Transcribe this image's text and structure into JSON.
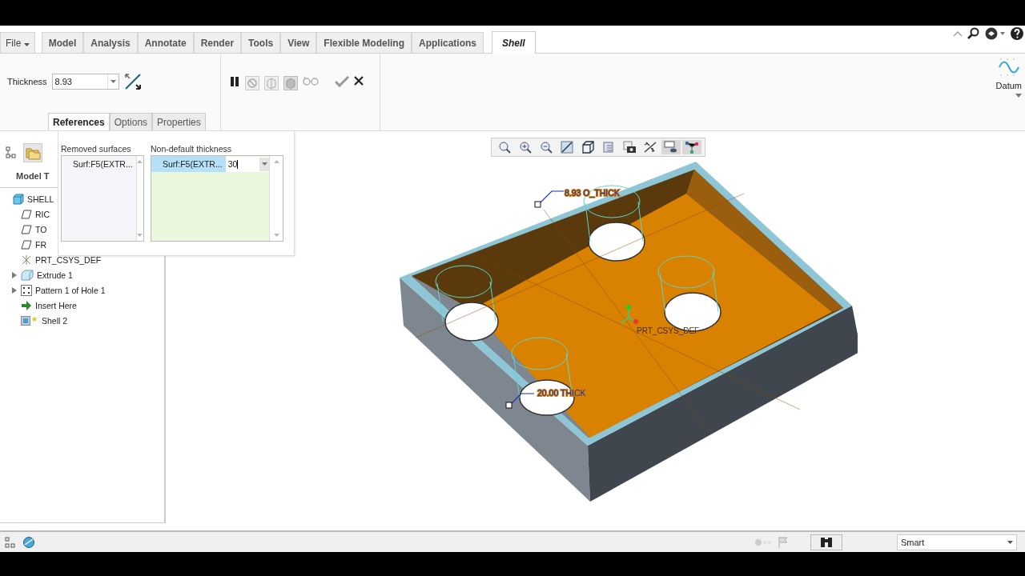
{
  "menu_tabs": [
    {
      "label": "File",
      "kind": "menu",
      "selected": false
    },
    {
      "label": "Model",
      "kind": "tab",
      "selected": false
    },
    {
      "label": "Analysis",
      "kind": "tab",
      "selected": false
    },
    {
      "label": "Annotate",
      "kind": "tab",
      "selected": false
    },
    {
      "label": "Render",
      "kind": "tab",
      "selected": false
    },
    {
      "label": "Tools",
      "kind": "tab",
      "selected": false
    },
    {
      "label": "View",
      "kind": "tab",
      "selected": false
    },
    {
      "label": "Flexible Modeling",
      "kind": "tab",
      "selected": false
    },
    {
      "label": "Applications",
      "kind": "tab",
      "selected": false
    },
    {
      "label": "Shell",
      "kind": "tab",
      "selected": true
    }
  ],
  "ribbon": {
    "thickness_label": "Thickness",
    "thickness_value": "8.93",
    "datum_label": "Datum"
  },
  "dashboard_tabs": [
    {
      "label": "References",
      "selected": true
    },
    {
      "label": "Options",
      "selected": false
    },
    {
      "label": "Properties",
      "selected": false
    }
  ],
  "references_panel": {
    "removed_label": "Removed surfaces",
    "removed_items": [
      "Surf:F5(EXTR..."
    ],
    "nondefault_label": "Non-default thickness",
    "nondefault_rows": [
      {
        "surface": "Surf:F5(EXTR...",
        "value": "30",
        "selected": true
      }
    ]
  },
  "model_tree": {
    "header": "Model T",
    "items": [
      {
        "label": "SHELL",
        "kind": "part"
      },
      {
        "label": "RIC",
        "kind": "plane"
      },
      {
        "label": "TO",
        "kind": "plane"
      },
      {
        "label": "FR",
        "kind": "plane"
      },
      {
        "label": "PRT_CSYS_DEF",
        "kind": "csys"
      },
      {
        "label": "Extrude 1",
        "kind": "extrude",
        "expanded": false
      },
      {
        "label": "Pattern 1 of Hole 1",
        "kind": "pattern",
        "expanded": false
      },
      {
        "label": "Insert Here",
        "kind": "insert"
      },
      {
        "label": "Shell 2",
        "kind": "shell"
      }
    ]
  },
  "viewport": {
    "annotations": [
      "8.93 O_THICK",
      "20.00 THICK",
      "PRT_CSYS_DEF"
    ]
  },
  "status_bar": {
    "filter": "Smart"
  }
}
